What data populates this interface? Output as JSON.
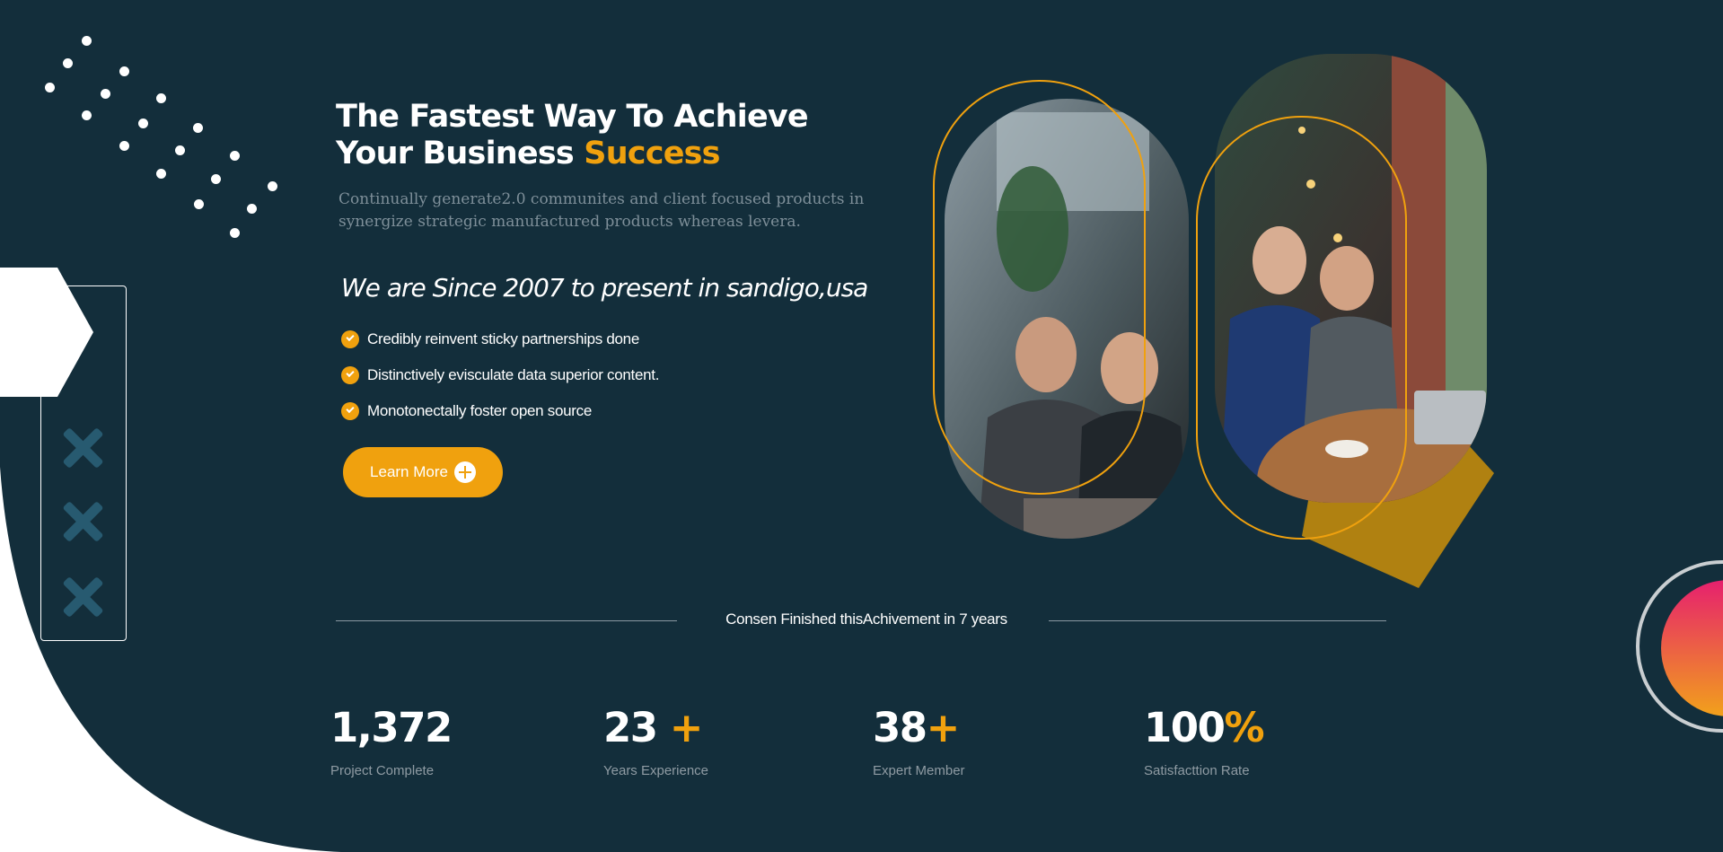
{
  "hero": {
    "headline_line1": "The Fastest Way To Achieve",
    "headline_line2_prefix": "Your Business ",
    "headline_accent": "Success",
    "description_line1": "Continually generate2.0 communites and client focused products in",
    "description_line2": "synergize strategic manufactured products whereas levera.",
    "since_text": "We are Since 2007 to present in sandigo,usa",
    "features": [
      "Credibly reinvent sticky partnerships done",
      "Distinctively evisculate data superior content.",
      "Monotonectally foster open source"
    ],
    "cta_label": "Learn More"
  },
  "achievement": {
    "divider_label": "Consen Finished thisAchivement in 7 years"
  },
  "stats": [
    {
      "number": "1,372",
      "suffix": "",
      "label": "Project Complete"
    },
    {
      "number": "23",
      "suffix": " +",
      "label": "Years Experience"
    },
    {
      "number": "38",
      "suffix": "+",
      "label": "Expert Member"
    },
    {
      "number": "100",
      "suffix": "%",
      "label": "Satisfacttion Rate"
    }
  ],
  "colors": {
    "background": "#132e3b",
    "accent": "#f0a10e",
    "x_mark": "#275a70",
    "muted_text": "#8f9ba3"
  },
  "icons": {
    "check": "check-circle-icon",
    "cta": "plus-circle-icon",
    "decor": [
      "dot-pattern",
      "hexagon-shape",
      "x-mark-icon"
    ]
  }
}
